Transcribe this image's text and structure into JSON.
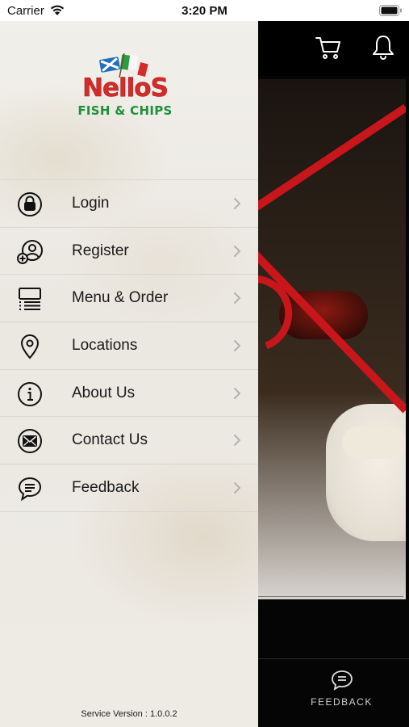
{
  "status_bar": {
    "carrier": "Carrier",
    "time": "3:20 PM"
  },
  "logo": {
    "name": "NelloS",
    "subtitle": "FISH & CHIPS"
  },
  "menu": {
    "items": [
      {
        "label": "Login",
        "icon": "lock-icon"
      },
      {
        "label": "Register",
        "icon": "add-user-icon"
      },
      {
        "label": "Menu & Order",
        "icon": "menu-list-icon"
      },
      {
        "label": "Locations",
        "icon": "location-pin-icon"
      },
      {
        "label": "About Us",
        "icon": "info-icon"
      },
      {
        "label": "Contact Us",
        "icon": "envelope-icon"
      },
      {
        "label": "Feedback",
        "icon": "chat-bubble-icon"
      }
    ]
  },
  "footer": {
    "service_version": "Service Version : 1.0.0.2"
  },
  "background": {
    "tab_feedback_label": "FEEDBACK"
  },
  "colors": {
    "brand_red": "#d42b2b",
    "brand_green": "#1f8f3a",
    "drawer_bg": "#eeebe5",
    "app_bg": "#000000"
  }
}
